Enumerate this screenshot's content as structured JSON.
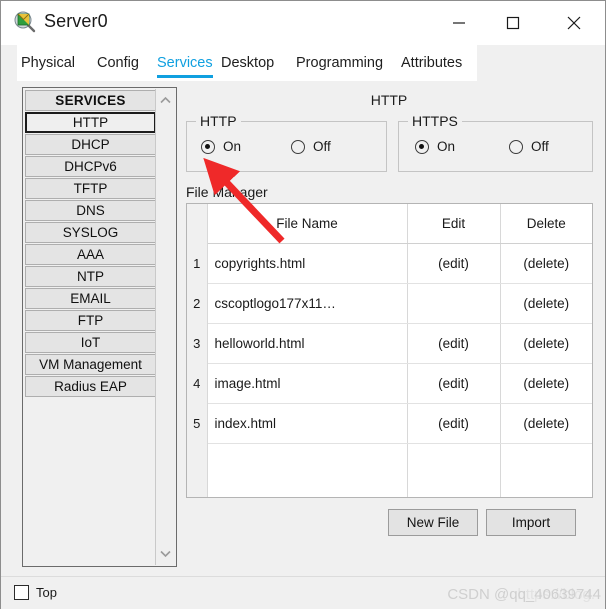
{
  "window": {
    "title": "Server0",
    "icon": "packet-tracer-server-icon",
    "controls": {
      "minimize": "—",
      "maximize": "□",
      "close": "✕"
    }
  },
  "tabs": [
    {
      "label": "Physical",
      "active": false
    },
    {
      "label": "Config",
      "active": false
    },
    {
      "label": "Services",
      "active": true
    },
    {
      "label": "Desktop",
      "active": false
    },
    {
      "label": "Programming",
      "active": false
    },
    {
      "label": "Attributes",
      "active": false
    }
  ],
  "sidebar": {
    "header": "SERVICES",
    "items": [
      {
        "label": "HTTP",
        "selected": true
      },
      {
        "label": "DHCP",
        "selected": false
      },
      {
        "label": "DHCPv6",
        "selected": false
      },
      {
        "label": "TFTP",
        "selected": false
      },
      {
        "label": "DNS",
        "selected": false
      },
      {
        "label": "SYSLOG",
        "selected": false
      },
      {
        "label": "AAA",
        "selected": false
      },
      {
        "label": "NTP",
        "selected": false
      },
      {
        "label": "EMAIL",
        "selected": false
      },
      {
        "label": "FTP",
        "selected": false
      },
      {
        "label": "IoT",
        "selected": false
      },
      {
        "label": "VM Management",
        "selected": false
      },
      {
        "label": "Radius EAP",
        "selected": false
      }
    ],
    "scroll_up_icon": "chevron-up-icon",
    "scroll_down_icon": "chevron-down-icon"
  },
  "pane": {
    "title": "HTTP",
    "http_group": {
      "label": "HTTP",
      "on_label": "On",
      "off_label": "Off",
      "selected": "On"
    },
    "https_group": {
      "label": "HTTPS",
      "on_label": "On",
      "off_label": "Off",
      "selected": "On"
    },
    "file_manager_label": "File Manager",
    "table": {
      "columns": [
        "",
        "File Name",
        "Edit",
        "Delete"
      ],
      "rows": [
        {
          "index": "1",
          "name": "copyrights.html",
          "edit": "(edit)",
          "delete": "(delete)"
        },
        {
          "index": "2",
          "name": "cscoptlogo177x11…",
          "edit": "",
          "delete": "(delete)"
        },
        {
          "index": "3",
          "name": "helloworld.html",
          "edit": "(edit)",
          "delete": "(delete)"
        },
        {
          "index": "4",
          "name": "image.html",
          "edit": "(edit)",
          "delete": "(delete)"
        },
        {
          "index": "5",
          "name": "index.html",
          "edit": "(edit)",
          "delete": "(delete)"
        }
      ]
    },
    "buttons": {
      "new_file": "New File",
      "import": "Import"
    }
  },
  "statusbar": {
    "top_label": "Top",
    "top_checked": false,
    "watermark_url": "https://blog.",
    "watermark_name": "CSDN @qq_40639744"
  },
  "annotation": {
    "type": "red-arrow",
    "color": "#ef2929",
    "points_to": "http-on-radio"
  },
  "colors": {
    "accent": "#10a0e0",
    "panel": "#f0f0f0",
    "button": "#e3e3e3",
    "annotation_red": "#ef2929"
  }
}
